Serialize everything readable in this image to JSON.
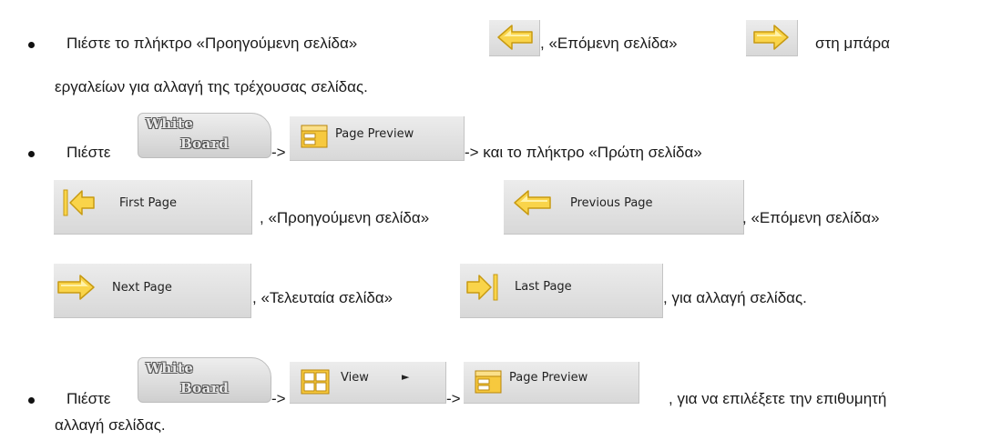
{
  "bullet1": {
    "text_a": "Πιέστε το πλήκτρο «Προηγούμενη σελίδα»",
    "text_b": ", «Επόμενη σελίδα»",
    "text_c": "στη μπάρα",
    "text_d": "εργαλείων για αλλαγή της τρέχουσας σελίδας."
  },
  "bullet2": {
    "text_a": "Πιέστε",
    "arrow1": "->",
    "text_b": "-> και το πλήκτρο «Πρώτη σελίδα»",
    "text_c": ", «Προηγούμενη σελίδα»",
    "text_d": ", «Επόμενη σελίδα»",
    "text_e": ", «Τελευταία σελίδα»",
    "text_f": ", για αλλαγή σελίδας."
  },
  "bullet3": {
    "text_a": "Πιέστε",
    "arrow1": "->",
    "arrow2": "->",
    "text_b": ", για να επιλέξετε την επιθυμητή",
    "text_c": "αλλαγή σελίδας."
  },
  "whiteboard": {
    "line1": "White",
    "line2": "Board"
  },
  "buttons": {
    "page_preview": "Page Preview",
    "first_page": "First Page",
    "previous_page": "Previous Page",
    "next_page": "Next Page",
    "last_page": "Last Page",
    "view": "View",
    "submenu_arrow": "►"
  },
  "icons": [
    "arrow-left-icon",
    "arrow-right-icon",
    "page-preview-icon",
    "first-page-icon",
    "last-page-icon",
    "view-icon"
  ],
  "colors": {
    "arrow_fill": "#f9d44a",
    "arrow_stroke": "#c79a12",
    "button_bg": "#e0e0e0"
  }
}
